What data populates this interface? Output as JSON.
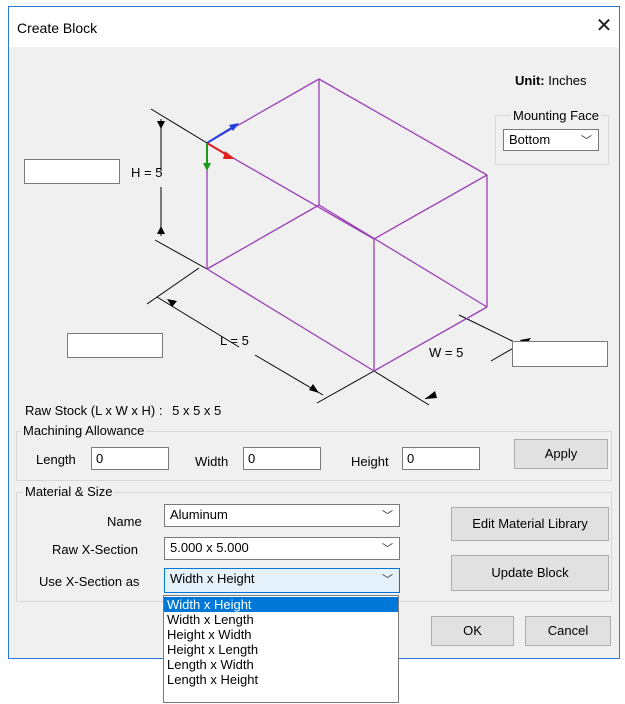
{
  "window": {
    "title": "Create Block",
    "close_glyph": "✕"
  },
  "unit": {
    "label": "Unit:",
    "value": "Inches"
  },
  "mounting_face": {
    "label": "Mounting Face",
    "value": "Bottom"
  },
  "diagram": {
    "h_label": "H = 5",
    "l_label": "L = 5",
    "w_label": "W = 5",
    "h_input": "",
    "l_input": "",
    "w_input": ""
  },
  "raw_stock": {
    "label": "Raw Stock (L x W x H) :",
    "value": "5 x 5 x 5"
  },
  "machining_allowance": {
    "title": "Machining Allowance",
    "length_label": "Length",
    "length_value": "0",
    "width_label": "Width",
    "width_value": "0",
    "height_label": "Height",
    "height_value": "0",
    "apply_label": "Apply"
  },
  "material": {
    "title": "Material & Size",
    "name_label": "Name",
    "name_value": "Aluminum",
    "xsection_label": "Raw X-Section",
    "xsection_value": "5.000 x 5.000",
    "use_label": "Use X-Section as",
    "use_value": "Width x Height",
    "edit_library_label": "Edit Material Library",
    "update_label": "Update Block"
  },
  "dropdown_options": [
    "Width x Height",
    "Width x Length",
    "Height x Width",
    "Height x Length",
    "Length x Width",
    "Length x Height"
  ],
  "footer": {
    "ok_label": "OK",
    "cancel_label": "Cancel"
  },
  "colors": {
    "box_edges": "#9b3fb5",
    "axis_x": "#e02020",
    "axis_y": "#1a9a1a",
    "axis_z": "#2040e0",
    "selection": "#0078d7"
  }
}
